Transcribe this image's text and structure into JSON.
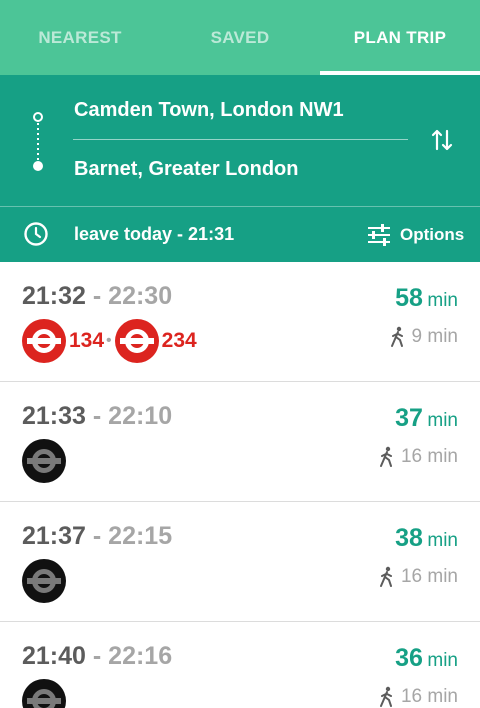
{
  "tabs": [
    {
      "label": "NEAREST",
      "active": false
    },
    {
      "label": "SAVED",
      "active": false
    },
    {
      "label": "PLAN TRIP",
      "active": true
    }
  ],
  "route": {
    "from": "Camden Town, London NW1",
    "to": "Barnet, Greater London",
    "swap_icon": "swap-vertical-icon"
  },
  "options_bar": {
    "leave": "leave today - 21:31",
    "options_label": "Options",
    "clock_icon": "clock-icon",
    "options_icon": "sliders-icon"
  },
  "results": [
    {
      "depart": "21:32",
      "sep": " - ",
      "arrive": "22:30",
      "duration": "58",
      "unit": "min",
      "walk": "9 min",
      "modes": [
        {
          "type": "bus",
          "route": "134"
        },
        {
          "type": "bus",
          "route": "234"
        }
      ]
    },
    {
      "depart": "21:33",
      "sep": " - ",
      "arrive": "22:10",
      "duration": "37",
      "unit": "min",
      "walk": "16 min",
      "modes": [
        {
          "type": "tube"
        }
      ]
    },
    {
      "depart": "21:37",
      "sep": " - ",
      "arrive": "22:15",
      "duration": "38",
      "unit": "min",
      "walk": "16 min",
      "modes": [
        {
          "type": "tube"
        }
      ]
    },
    {
      "depart": "21:40",
      "sep": " - ",
      "arrive": "22:16",
      "duration": "36",
      "unit": "min",
      "walk": "16 min",
      "modes": [
        {
          "type": "tube"
        }
      ]
    }
  ],
  "colors": {
    "tab_bar": "#4cc597",
    "header": "#16a085",
    "accent": "#16a085",
    "bus_red": "#dc241f",
    "tube_black": "#111111"
  }
}
